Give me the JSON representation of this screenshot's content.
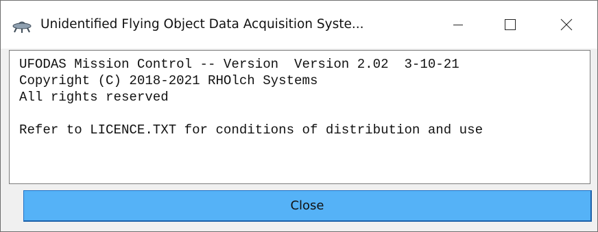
{
  "window": {
    "title": "Unidentified Flying Object Data Acquisition Syste...",
    "title_icon": "ufo-icon",
    "controls": {
      "minimize_icon": "minimize-icon",
      "maximize_icon": "maximize-icon",
      "close_icon": "close-icon"
    }
  },
  "console": {
    "lines": [
      "UFODAS Mission Control -- Version  Version 2.02  3-10-21",
      "Copyright (C) 2018-2021 RHOlch Systems",
      "All rights reserved",
      "",
      "Refer to LICENCE.TXT for conditions of distribution and use"
    ]
  },
  "buttons": {
    "close_label": "Close"
  },
  "colors": {
    "close_button_bg": "#55b2f7",
    "window_bg": "#f0f0f0",
    "titlebar_bg": "#ffffff"
  }
}
